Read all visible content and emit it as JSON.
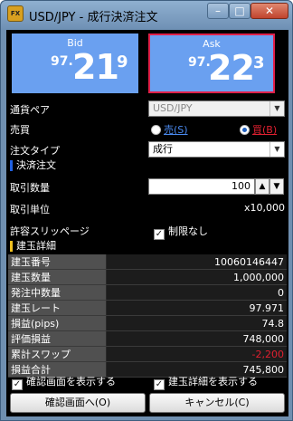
{
  "window": {
    "title": "USD/JPY - 成行決済注文",
    "icon_text": "FX",
    "controls": {
      "minimize": "–",
      "maximize": "□",
      "close": "✕"
    }
  },
  "rates": {
    "bid": {
      "label": "Bid",
      "prefix": "97.",
      "big": "21",
      "sup": "9"
    },
    "ask": {
      "label": "Ask",
      "prefix": "97.",
      "big": "22",
      "sup": "3"
    }
  },
  "form": {
    "pair_label": "通貨ペア",
    "pair_value": "USD/JPY",
    "side_label": "売買",
    "side_sell": "売(S)",
    "side_buy": "買(B)",
    "side_selected": "buy",
    "order_type_label": "注文タイプ",
    "order_type_value": "成行"
  },
  "settle": {
    "header": "決済注文",
    "qty_label": "取引数量",
    "qty_value": "100",
    "unit_label": "取引単位",
    "unit_value": "x10,000",
    "slippage_label": "許容スリッページ",
    "slippage_check_label": "制限なし",
    "slippage_checked": true
  },
  "position": {
    "header": "建玉詳細",
    "rows": [
      {
        "label": "建玉番号",
        "value": "10060146447",
        "color": "#ffffff"
      },
      {
        "label": "建玉数量",
        "value": "1,000,000",
        "color": "#ffffff"
      },
      {
        "label": "発注中数量",
        "value": "0",
        "color": "#ffffff"
      },
      {
        "label": "建玉レート",
        "value": "97.971",
        "color": "#ffffff"
      },
      {
        "label": "損益(pips)",
        "value": "74.8",
        "color": "#ffffff"
      },
      {
        "label": "評価損益",
        "value": "748,000",
        "color": "#ffffff"
      },
      {
        "label": "累計スワップ",
        "value": "-2,200",
        "color": "#e02030"
      },
      {
        "label": "損益合計",
        "value": "745,800",
        "color": "#ffffff"
      }
    ]
  },
  "footer": {
    "confirm_check_label": "確認画面を表示する",
    "detail_check_label": "建玉詳細を表示する",
    "confirm_button": "確認画面へ(O)",
    "cancel_button": "キャンセル(C)"
  },
  "colors": {
    "bid_box": "#6aa0f0",
    "ask_border": "#e0204a",
    "settle_marker": "#2060e0",
    "detail_marker": "#f0c020"
  }
}
